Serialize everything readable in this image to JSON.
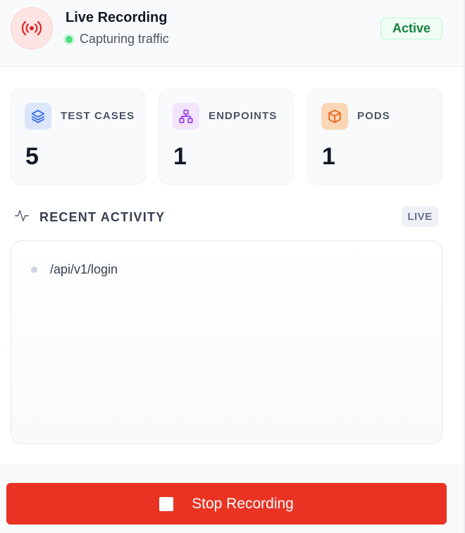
{
  "header": {
    "icon": "broadcast-icon",
    "title": "Live Recording",
    "status_text": "Capturing traffic",
    "badge": "Active",
    "colors": {
      "accent": "#ea3323",
      "status": "#4ade80",
      "badge_text": "#15803d"
    }
  },
  "stats": [
    {
      "label": "TEST CASES",
      "value": "5",
      "icon": "layers-icon",
      "color": "#2563eb"
    },
    {
      "label": "ENDPOINTS",
      "value": "1",
      "icon": "sitemap-icon",
      "color": "#9333ea"
    },
    {
      "label": "PODS",
      "value": "1",
      "icon": "cube-icon",
      "color": "#ea580c"
    }
  ],
  "activity": {
    "title": "RECENT ACTIVITY",
    "icon": "pulse-icon",
    "badge": "LIVE",
    "items": [
      {
        "path": "/api/v1/login"
      }
    ]
  },
  "footer": {
    "button_label": "Stop Recording",
    "button_icon": "stop-icon"
  }
}
